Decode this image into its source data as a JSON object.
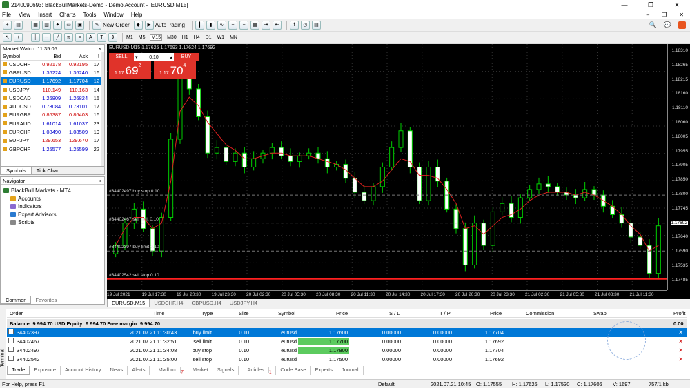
{
  "window": {
    "title": "2140090693: BlackBullMarkets-Demo - Demo Account - [EURUSD,M15]",
    "controls": [
      "—",
      "❐",
      "✕"
    ]
  },
  "menu": [
    "File",
    "View",
    "Insert",
    "Charts",
    "Tools",
    "Window",
    "Help"
  ],
  "toolbar": {
    "new_order": "New Order",
    "autotrading": "AutoTrading",
    "timeframes": [
      "M1",
      "M5",
      "M15",
      "M30",
      "H1",
      "H4",
      "D1",
      "W1",
      "MN"
    ],
    "active_timeframe": "M15"
  },
  "market_watch": {
    "title": "Market Watch: 11:35:05",
    "columns": [
      "Symbol",
      "Bid",
      "Ask",
      "!"
    ],
    "rows": [
      {
        "symbol": "USDCHF",
        "bid": "0.92178",
        "ask": "0.92195",
        "spread": "17"
      },
      {
        "symbol": "GBPUSD",
        "bid": "1.36224",
        "ask": "1.36240",
        "spread": "16"
      },
      {
        "symbol": "EURUSD",
        "bid": "1.17692",
        "ask": "1.17704",
        "spread": "12"
      },
      {
        "symbol": "USDJPY",
        "bid": "110.149",
        "ask": "110.163",
        "spread": "14"
      },
      {
        "symbol": "USDCAD",
        "bid": "1.26809",
        "ask": "1.26824",
        "spread": "15"
      },
      {
        "symbol": "AUDUSD",
        "bid": "0.73084",
        "ask": "0.73101",
        "spread": "17"
      },
      {
        "symbol": "EURGBP",
        "bid": "0.86387",
        "ask": "0.86403",
        "spread": "16"
      },
      {
        "symbol": "EURAUD",
        "bid": "1.61014",
        "ask": "1.61037",
        "spread": "23"
      },
      {
        "symbol": "EURCHF",
        "bid": "1.08490",
        "ask": "1.08509",
        "spread": "19"
      },
      {
        "symbol": "EURJPY",
        "bid": "129.653",
        "ask": "129.670",
        "spread": "17"
      },
      {
        "symbol": "GBPCHF",
        "bid": "1.25577",
        "ask": "1.25599",
        "spread": "22"
      }
    ],
    "tabs": [
      "Symbols",
      "Tick Chart"
    ]
  },
  "navigator": {
    "title": "Navigator",
    "root": "BlackBull Markets - MT4",
    "items": [
      "Accounts",
      "Indicators",
      "Expert Advisors",
      "Scripts"
    ],
    "tabs": [
      "Common",
      "Favorites"
    ]
  },
  "chart": {
    "header": "EURUSD,M15  1.17625 1.17693 1.17624 1.17692",
    "sell_label": "SELL",
    "buy_label": "BUY",
    "lot": "0.10",
    "sell_price": {
      "prefix": "1.17",
      "big": "69",
      "sup": "2"
    },
    "buy_price": {
      "prefix": "1.17",
      "big": "70",
      "sup": "4"
    },
    "levels": [
      {
        "label": "#34402497 buy stop 0.10",
        "price": 1.178
      },
      {
        "label": "#34402467 sell limit 0.10",
        "price": 1.177
      },
      {
        "label": "#34402397 buy limit 0.10",
        "price": 1.176
      },
      {
        "label": "#34402542 sell stop 0.10",
        "price": 1.175
      }
    ],
    "y_labels": [
      "1.18310",
      "1.18265",
      "1.18215",
      "1.18160",
      "1.18110",
      "1.18060",
      "1.18005",
      "1.17955",
      "1.17905",
      "1.17850",
      "1.17800",
      "1.17745",
      "1.17692",
      "1.17640",
      "1.17590",
      "1.17535",
      "1.17485"
    ],
    "current_price": "1.17692",
    "x_labels": [
      "19 Jul 2021",
      "19 Jul 17:30",
      "19 Jul 20:30",
      "19 Jul 23:30",
      "20 Jul 02:30",
      "20 Jul 05:30",
      "20 Jul 08:30",
      "20 Jul 11:30",
      "20 Jul 14:30",
      "20 Jul 17:30",
      "20 Jul 20:30",
      "20 Jul 23:30",
      "21 Jul 02:30",
      "21 Jul 05:30",
      "21 Jul 08:30",
      "21 Jul 11:30"
    ],
    "tabs": [
      "EURUSD,M15",
      "USDCHF,H4",
      "GBPUSD,H4",
      "USDJPY,H4"
    ]
  },
  "chart_data": {
    "type": "candlestick",
    "symbol": "EURUSD",
    "timeframe": "M15",
    "ylim": [
      1.1746,
      1.1834
    ],
    "close_approx": [
      1.1762,
      1.177,
      1.1775,
      1.1768,
      1.176,
      1.1772,
      1.18,
      1.1822,
      1.1818,
      1.1808,
      1.1795,
      1.1797,
      1.1792,
      1.1795,
      1.179,
      1.1793,
      1.1795,
      1.1797,
      1.1794,
      1.1792,
      1.1794,
      1.1795,
      1.1793,
      1.179,
      1.1791,
      1.1786,
      1.1781,
      1.1778,
      1.1783,
      1.179,
      1.1797,
      1.1803,
      1.179,
      1.1778,
      1.179,
      1.1785,
      1.1775,
      1.1768,
      1.1755,
      1.177,
      1.1762,
      1.1774,
      1.1777,
      1.1772,
      1.1779,
      1.1782,
      1.1784,
      1.1783,
      1.1781,
      1.178,
      1.1779,
      1.1782,
      1.178,
      1.1776,
      1.1773,
      1.177,
      1.1765,
      1.1762,
      1.1752,
      1.1769
    ],
    "ma_approx": [
      1.1762,
      1.1768,
      1.1772,
      1.1772,
      1.1768,
      1.177,
      1.1785,
      1.181,
      1.1815,
      1.1812,
      1.1806,
      1.1802,
      1.1798,
      1.1796,
      1.1793,
      1.1793,
      1.1794,
      1.1795,
      1.1795,
      1.1794,
      1.1794,
      1.1794,
      1.1793,
      1.1792,
      1.1791,
      1.1789,
      1.1786,
      1.1783,
      1.1783,
      1.1785,
      1.1789,
      1.1793,
      1.1792,
      1.1787,
      1.1787,
      1.1786,
      1.1782,
      1.1777,
      1.1768,
      1.1769,
      1.1766,
      1.1769,
      1.1772,
      1.1773,
      1.1775,
      1.1778,
      1.178,
      1.1781,
      1.1781,
      1.1781,
      1.178,
      1.1781,
      1.178,
      1.1778,
      1.1776,
      1.1773,
      1.1769,
      1.1766,
      1.176,
      1.1762
    ]
  },
  "terminal": {
    "side_label": "Terminal",
    "columns": [
      "Order",
      "Time",
      "Type",
      "Size",
      "Symbol",
      "Price",
      "S / L",
      "T / P",
      "Price",
      "Commission",
      "Swap",
      "Profit"
    ],
    "balance": "Balance: 9 994.70 USD  Equity: 9 994.70  Free margin: 9 994.70",
    "balance_profit": "0.00",
    "orders": [
      {
        "order": "34402397",
        "time": "2021.07.21 11:30:43",
        "type": "buy limit",
        "size": "0.10",
        "symbol": "eurusd",
        "price": "1.17600",
        "sl": "0.00000",
        "tp": "0.00000",
        "cur": "1.17704",
        "hl": false,
        "sel": true
      },
      {
        "order": "34402467",
        "time": "2021.07.21 11:32:51",
        "type": "sell limit",
        "size": "0.10",
        "symbol": "eurusd",
        "price": "1.17700",
        "sl": "0.00000",
        "tp": "0.00000",
        "cur": "1.17692",
        "hl": true,
        "sel": false
      },
      {
        "order": "34402497",
        "time": "2021.07.21 11:34:08",
        "type": "buy stop",
        "size": "0.10",
        "symbol": "eurusd",
        "price": "1.17800",
        "sl": "0.00000",
        "tp": "0.00000",
        "cur": "1.17704",
        "hl": true,
        "sel": false
      },
      {
        "order": "34402542",
        "time": "2021.07.21 11:35:00",
        "type": "sell stop",
        "size": "0.10",
        "symbol": "eurusd",
        "price": "1.17500",
        "sl": "0.00000",
        "tp": "0.00000",
        "cur": "1.17692",
        "hl": false,
        "sel": false
      }
    ],
    "tabs": [
      "Trade",
      "Exposure",
      "Account History",
      "News",
      "Alerts",
      "Mailbox",
      "Market",
      "Signals",
      "Articles",
      "Code Base",
      "Experts",
      "Journal"
    ],
    "mailbox_badge": "7",
    "articles_badge": "1"
  },
  "status": {
    "help": "For Help, press F1",
    "profile": "Default",
    "datetime": "2021.07.21 10:45",
    "open": "O: 1.17555",
    "high": "H: 1.17626",
    "low": "L: 1.17530",
    "close": "C: 1.17606",
    "volume": "V: 1697",
    "traffic": "757/1 kb"
  }
}
